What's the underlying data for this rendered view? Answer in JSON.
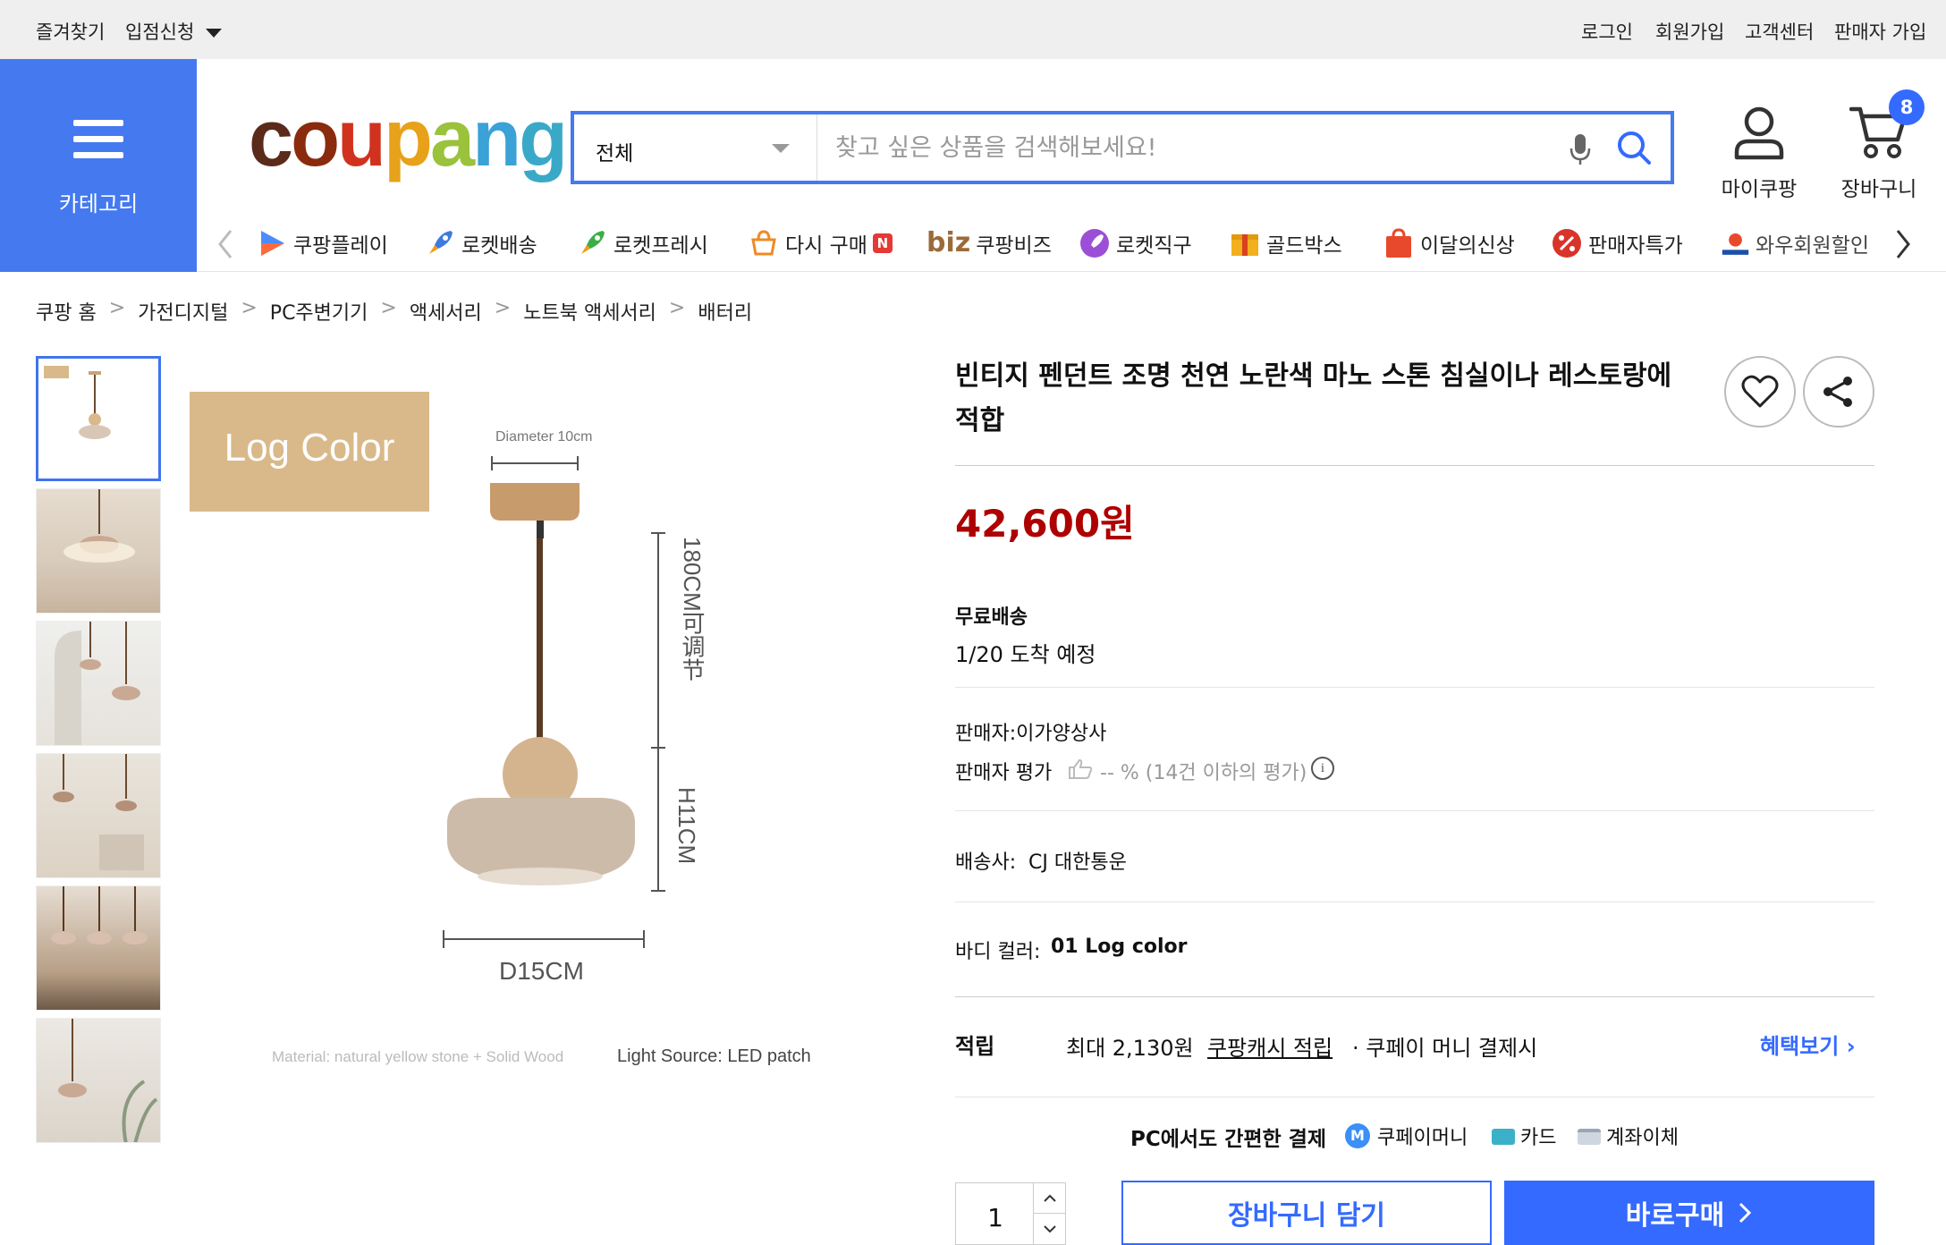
{
  "topbar": {
    "favorites": "즐겨찾기",
    "seller_apply": "입점신청",
    "login": "로그인",
    "signup": "회원가입",
    "customer_center": "고객센터",
    "seller_join": "판매자 가입"
  },
  "header": {
    "category_label": "카테고리",
    "logo_text": "coupang",
    "search": {
      "category_value": "전체",
      "placeholder": "찾고 싶은 상품을 검색해보세요!"
    },
    "my_coupang": "마이쿠팡",
    "cart_label": "장바구니",
    "cart_count": "8"
  },
  "category_nav": [
    {
      "label": "쿠팡플레이",
      "icon": "play-icon"
    },
    {
      "label": "로켓배송",
      "icon": "rocket-icon"
    },
    {
      "label": "로켓프레시",
      "icon": "rocket-fresh-icon"
    },
    {
      "label": "다시 구매",
      "icon": "repurchase-icon",
      "badge": "N"
    },
    {
      "label": "쿠팡비즈",
      "icon": "biz-icon",
      "prefix": "biz"
    },
    {
      "label": "로켓직구",
      "icon": "rocket-global-icon"
    },
    {
      "label": "골드박스",
      "icon": "goldbox-icon"
    },
    {
      "label": "이달의신상",
      "icon": "new-bag-icon"
    },
    {
      "label": "판매자특가",
      "icon": "percent-icon"
    },
    {
      "label": "와우회원할인",
      "icon": "wow-icon"
    }
  ],
  "breadcrumb": [
    "쿠팡 홈",
    "가전디지털",
    "PC주변기기",
    "액세서리",
    "노트북 액세서리",
    "배터리"
  ],
  "gallery": {
    "label_log_color": "Log Color",
    "diameter": "Diameter 10cm",
    "cord_length": "180CM可调节",
    "height": "H11CM",
    "width": "D15CM",
    "material": "Material: natural yellow stone + Solid Wood",
    "light_source": "Light Source: LED patch"
  },
  "product": {
    "title": "빈티지 펜던트 조명 천연 노란색 마노 스톤 침실이나 레스토랑에 적합",
    "price": "42,600원",
    "shipping_title": "무료배송",
    "arrival": "1/20 도착 예정",
    "seller": "판매자:이가양상사",
    "seller_rating_label": "판매자 평가",
    "seller_rating_value": "-- % (14건 이하의 평가)",
    "carrier_label": "배송사:",
    "carrier": "CJ 대한통운",
    "body_color_label": "바디 컬러:",
    "body_color_value": "01 Log color",
    "reward_label": "적립",
    "reward_max": "최대 2,130원",
    "reward_link": "쿠팡캐시 적립",
    "reward_note": "· 쿠페이 머니 결제시",
    "benefits_link": "혜택보기",
    "pc_pay_title": "PC에서도 간편한 결제",
    "pay_money": "쿠페이머니",
    "pay_card": "카드",
    "pay_transfer": "계좌이체",
    "quantity": "1",
    "add_to_cart": "장바구니 담기",
    "buy_now": "바로구매"
  },
  "colors": {
    "brand_blue": "#4479f0",
    "price_red": "#ae0000",
    "link_blue": "#346aff"
  }
}
